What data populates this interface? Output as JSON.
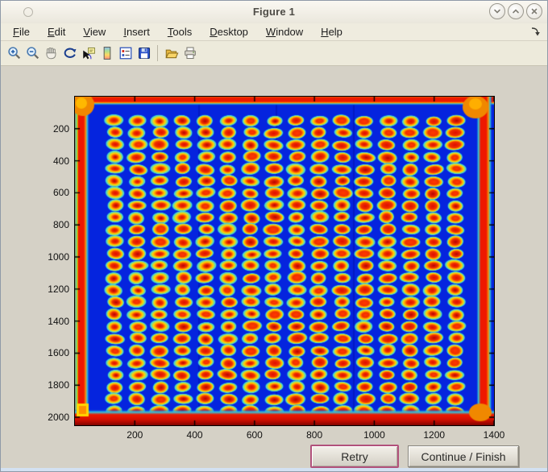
{
  "window": {
    "title": "Figure 1",
    "controls": [
      {
        "name": "minimize",
        "glyph": "chevron-down"
      },
      {
        "name": "maximize",
        "glyph": "chevron-up"
      },
      {
        "name": "close",
        "glyph": "x"
      }
    ]
  },
  "menu": {
    "items": [
      "File",
      "Edit",
      "View",
      "Insert",
      "Tools",
      "Desktop",
      "Window",
      "Help"
    ]
  },
  "toolbar": {
    "tools": [
      {
        "name": "zoom-in"
      },
      {
        "name": "zoom-out"
      },
      {
        "name": "pan"
      },
      {
        "name": "rotate-3d"
      },
      {
        "name": "data-cursor"
      },
      {
        "name": "colorbar"
      },
      {
        "name": "legend"
      },
      {
        "name": "save"
      },
      {
        "name": "open"
      },
      {
        "name": "print"
      }
    ]
  },
  "figure": {
    "axes": {
      "x_ticks": [
        200,
        400,
        600,
        800,
        1000,
        1200,
        1400
      ],
      "y_ticks": [
        200,
        400,
        600,
        800,
        1000,
        1200,
        1400,
        1600,
        1800,
        2000
      ],
      "x_range": [
        0,
        1400
      ],
      "y_range": [
        0,
        2050
      ]
    },
    "chart_data": {
      "type": "heatmap",
      "title": "",
      "xlabel": "",
      "ylabel": "",
      "description": "Pseudocolor (jet colormap) scan image of a spotted microarray plate: blue field, bright red borders along all four edges with orange corner blobs, and a regular grid of assay spots (cyan halo, yellow-orange ring, red core).",
      "x_range": [
        0,
        1400
      ],
      "y_range": [
        0,
        2050
      ],
      "background_value_color": "#0524DE",
      "border_color": "#EE1800",
      "corner_blob_color": "#F08800",
      "spot_grid": {
        "cols": 16,
        "rows": 25,
        "x_start": 132,
        "x_step": 76,
        "y_start": 150,
        "y_step": 75.5
      },
      "spot_colors": {
        "halo": "#38D8E0",
        "ring": "#FFD800",
        "mid": "#FF8C00",
        "core": "#E01000"
      },
      "colormap": "jet"
    }
  },
  "buttons": {
    "retry": {
      "label": "Retry"
    },
    "continue_finish": {
      "label": "Continue / Finish"
    }
  }
}
